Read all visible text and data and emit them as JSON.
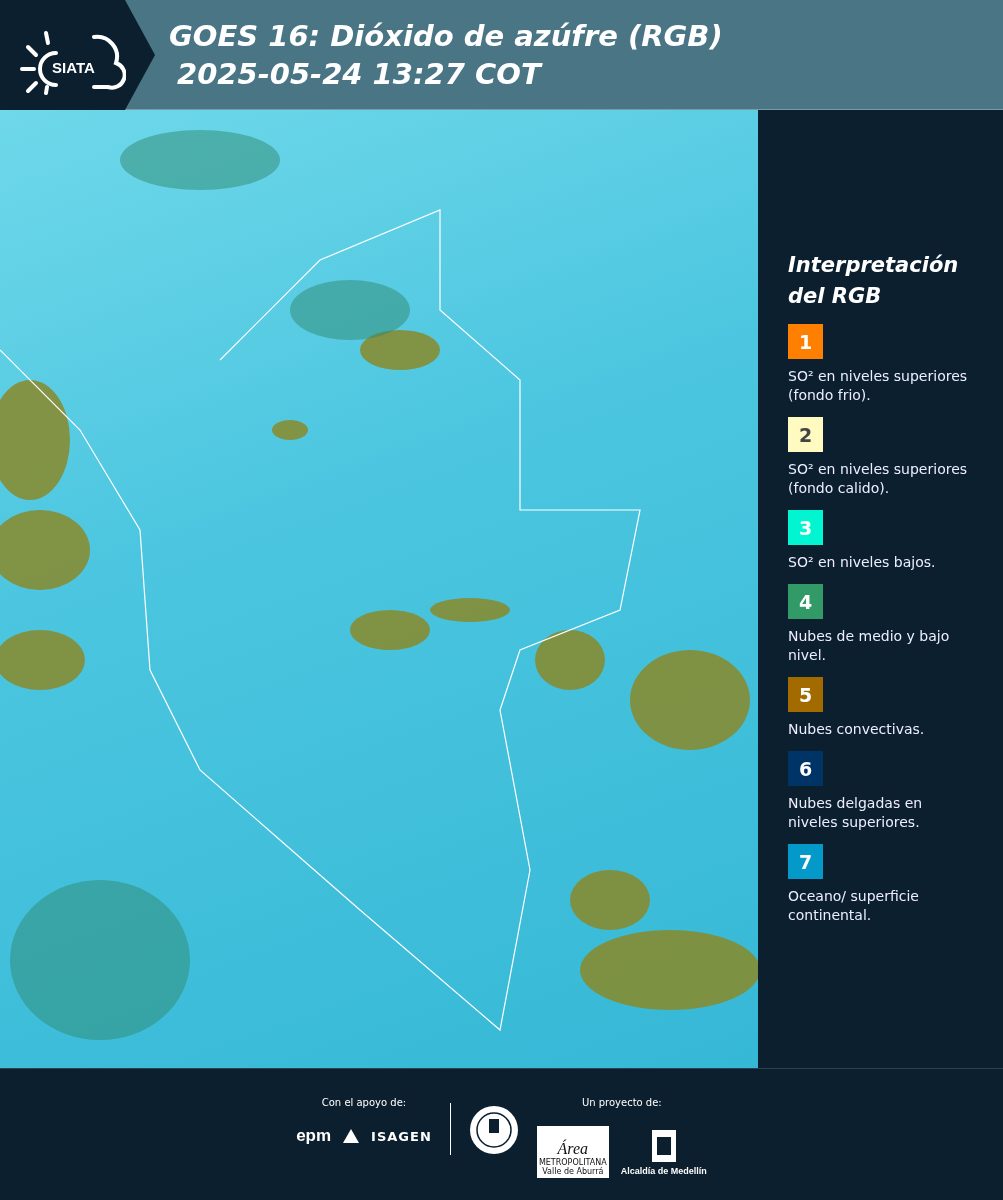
{
  "header": {
    "logo_text": "SIATA",
    "title_line_1": "GOES 16: Dióxido de azúfre (RGB)",
    "title_line_2": "2025-05-24 13:27 COT"
  },
  "legend": {
    "title_line_1": "Interpretación",
    "title_line_2": "del RGB",
    "items": [
      {
        "number": "1",
        "color": "#ff7f00",
        "text": "SO² en niveles superiores (fondo frio)."
      },
      {
        "number": "2",
        "color": "#fffbc0",
        "text": "SO² en niveles superiores (fondo calido)."
      },
      {
        "number": "3",
        "color": "#00f5d0",
        "text": "SO² en niveles bajos."
      },
      {
        "number": "4",
        "color": "#329a67",
        "text": "Nubes de medio y bajo nivel."
      },
      {
        "number": "5",
        "color": "#a36a00",
        "text": "Nubes convectivas."
      },
      {
        "number": "6",
        "color": "#003366",
        "text": "Nubes delgadas en niveles superiores."
      },
      {
        "number": "7",
        "color": "#0399c9",
        "text": "Oceano/ superficie continental."
      }
    ]
  },
  "footer": {
    "support_label": "Con el apoyo de:",
    "project_label": "Un proyecto de:",
    "epm": "epm",
    "isagen": "ISAGEN",
    "area": "Área",
    "metropolitana": "METROPOLITANA",
    "valle": "Valle de Aburrá",
    "alcaldia": "Alcaldía de Medellín"
  }
}
